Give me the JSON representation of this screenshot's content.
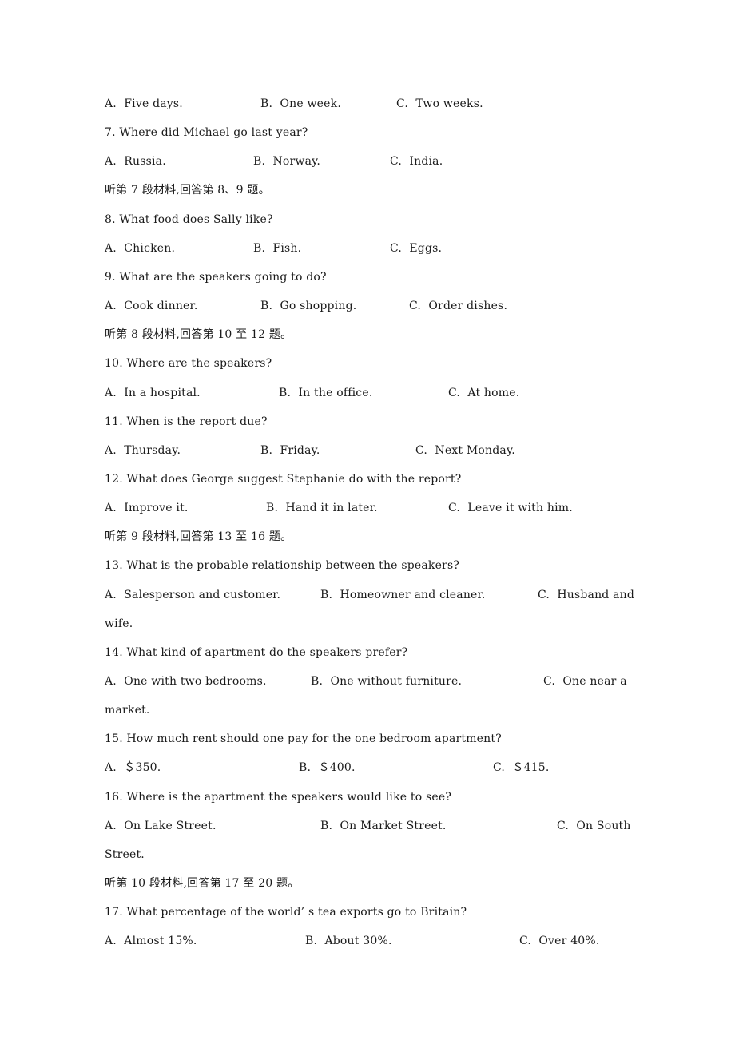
{
  "document": {
    "lines": [
      {
        "type": "options",
        "options": [
          {
            "label": "A.",
            "text": "Five days."
          },
          {
            "label": "B.",
            "text": "One week."
          },
          {
            "label": "C.",
            "text": "Two weeks."
          }
        ]
      },
      {
        "type": "question",
        "text": "7. Where did Michael go last year?"
      },
      {
        "type": "options",
        "options": [
          {
            "label": "A.",
            "text": "Russia."
          },
          {
            "label": "B.",
            "text": "Norway."
          },
          {
            "label": "C.",
            "text": "India."
          }
        ]
      },
      {
        "type": "section",
        "text": "听第 7 段材料,回答第 8、9 题。"
      },
      {
        "type": "question",
        "text": "8. What food does Sally like?"
      },
      {
        "type": "options",
        "options": [
          {
            "label": "A.",
            "text": "Chicken."
          },
          {
            "label": "B.",
            "text": "Fish."
          },
          {
            "label": "C.",
            "text": "Eggs."
          }
        ]
      },
      {
        "type": "question",
        "text": "9. What are the speakers going to do?"
      },
      {
        "type": "options",
        "options": [
          {
            "label": "A.",
            "text": "Cook dinner."
          },
          {
            "label": "B.",
            "text": "Go shopping."
          },
          {
            "label": "C.",
            "text": "Order dishes."
          }
        ]
      },
      {
        "type": "section",
        "text": "听第 8 段材料,回答第 10 至 12 题。"
      },
      {
        "type": "question",
        "text": "10. Where are the speakers?"
      },
      {
        "type": "options",
        "options": [
          {
            "label": "A.",
            "text": "In a hospital."
          },
          {
            "label": "B.",
            "text": "In the office."
          },
          {
            "label": "C.",
            "text": "At home."
          }
        ]
      },
      {
        "type": "question",
        "text": "11. When is the report due?"
      },
      {
        "type": "options",
        "options": [
          {
            "label": "A.",
            "text": "Thursday."
          },
          {
            "label": "B.",
            "text": "Friday."
          },
          {
            "label": "C.",
            "text": "Next Monday."
          }
        ]
      },
      {
        "type": "question",
        "text": "12. What does George suggest Stephanie do with the report?"
      },
      {
        "type": "options",
        "options": [
          {
            "label": "A.",
            "text": "Improve it."
          },
          {
            "label": "B.",
            "text": "Hand it in later."
          },
          {
            "label": "C.",
            "text": "Leave it with him."
          }
        ]
      },
      {
        "type": "section",
        "text": "听第 9 段材料,回答第 13 至 16 题。"
      },
      {
        "type": "question",
        "text": "13. What is the probable relationship between the speakers?"
      },
      {
        "type": "options",
        "options": [
          {
            "label": "A.",
            "text": "Salesperson and customer."
          },
          {
            "label": "B.",
            "text": "Homeowner and cleaner."
          },
          {
            "label": "C.",
            "text": "Husband and"
          }
        ]
      },
      {
        "type": "continuation",
        "text": "wife."
      },
      {
        "type": "question",
        "text": "14. What kind of apartment do the speakers prefer?"
      },
      {
        "type": "options",
        "options": [
          {
            "label": "A.",
            "text": "One with two bedrooms."
          },
          {
            "label": "B.",
            "text": "One without furniture."
          },
          {
            "label": "C.",
            "text": "One near a"
          }
        ]
      },
      {
        "type": "continuation",
        "text": "market."
      },
      {
        "type": "question",
        "text": "15. How much rent should one pay for the one bedroom apartment?"
      },
      {
        "type": "options",
        "options": [
          {
            "label": "A.",
            "text": "＄350."
          },
          {
            "label": "B.",
            "text": "＄400."
          },
          {
            "label": "C.",
            "text": "＄415."
          }
        ]
      },
      {
        "type": "question",
        "text": "16. Where is the apartment the speakers would like to see?"
      },
      {
        "type": "options",
        "options": [
          {
            "label": "A.",
            "text": "On Lake Street."
          },
          {
            "label": "B.",
            "text": "On Market Street."
          },
          {
            "label": "C.",
            "text": "On South"
          }
        ]
      },
      {
        "type": "continuation",
        "text": "Street."
      },
      {
        "type": "section",
        "text": "听第 10 段材料,回答第 17 至 20 题。"
      },
      {
        "type": "question",
        "text": "17. What percentage of the world’ s tea exports go to Britain?"
      },
      {
        "type": "options",
        "options": [
          {
            "label": "A.",
            "text": "Almost 15%."
          },
          {
            "label": "B.",
            "text": "About 30%."
          },
          {
            "label": "C.",
            "text": "Over 40%."
          }
        ]
      }
    ]
  }
}
